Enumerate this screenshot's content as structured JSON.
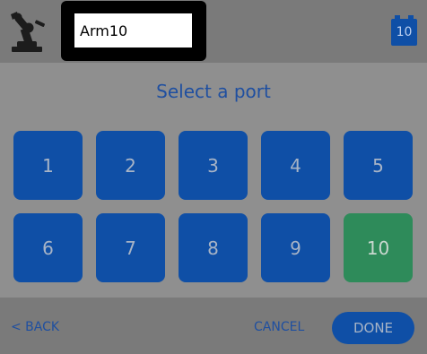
{
  "header": {
    "device_icon": "robot-arm-icon",
    "name_value": "Arm10",
    "selected_port_badge": "10",
    "badge_icon": "port-badge-icon"
  },
  "prompt": "Select a port",
  "ports": [
    {
      "label": "1",
      "selected": false
    },
    {
      "label": "2",
      "selected": false
    },
    {
      "label": "3",
      "selected": false
    },
    {
      "label": "4",
      "selected": false
    },
    {
      "label": "5",
      "selected": false
    },
    {
      "label": "6",
      "selected": false
    },
    {
      "label": "7",
      "selected": false
    },
    {
      "label": "8",
      "selected": false
    },
    {
      "label": "9",
      "selected": false
    },
    {
      "label": "10",
      "selected": true
    }
  ],
  "footer": {
    "back_label": "< BACK",
    "cancel_label": "CANCEL",
    "done_label": "DONE"
  },
  "colors": {
    "port_default": "#0f4fa6",
    "port_selected": "#2e8b5a",
    "text_accent": "#1f4fa0",
    "overlay_background": "#8f8f8f"
  }
}
